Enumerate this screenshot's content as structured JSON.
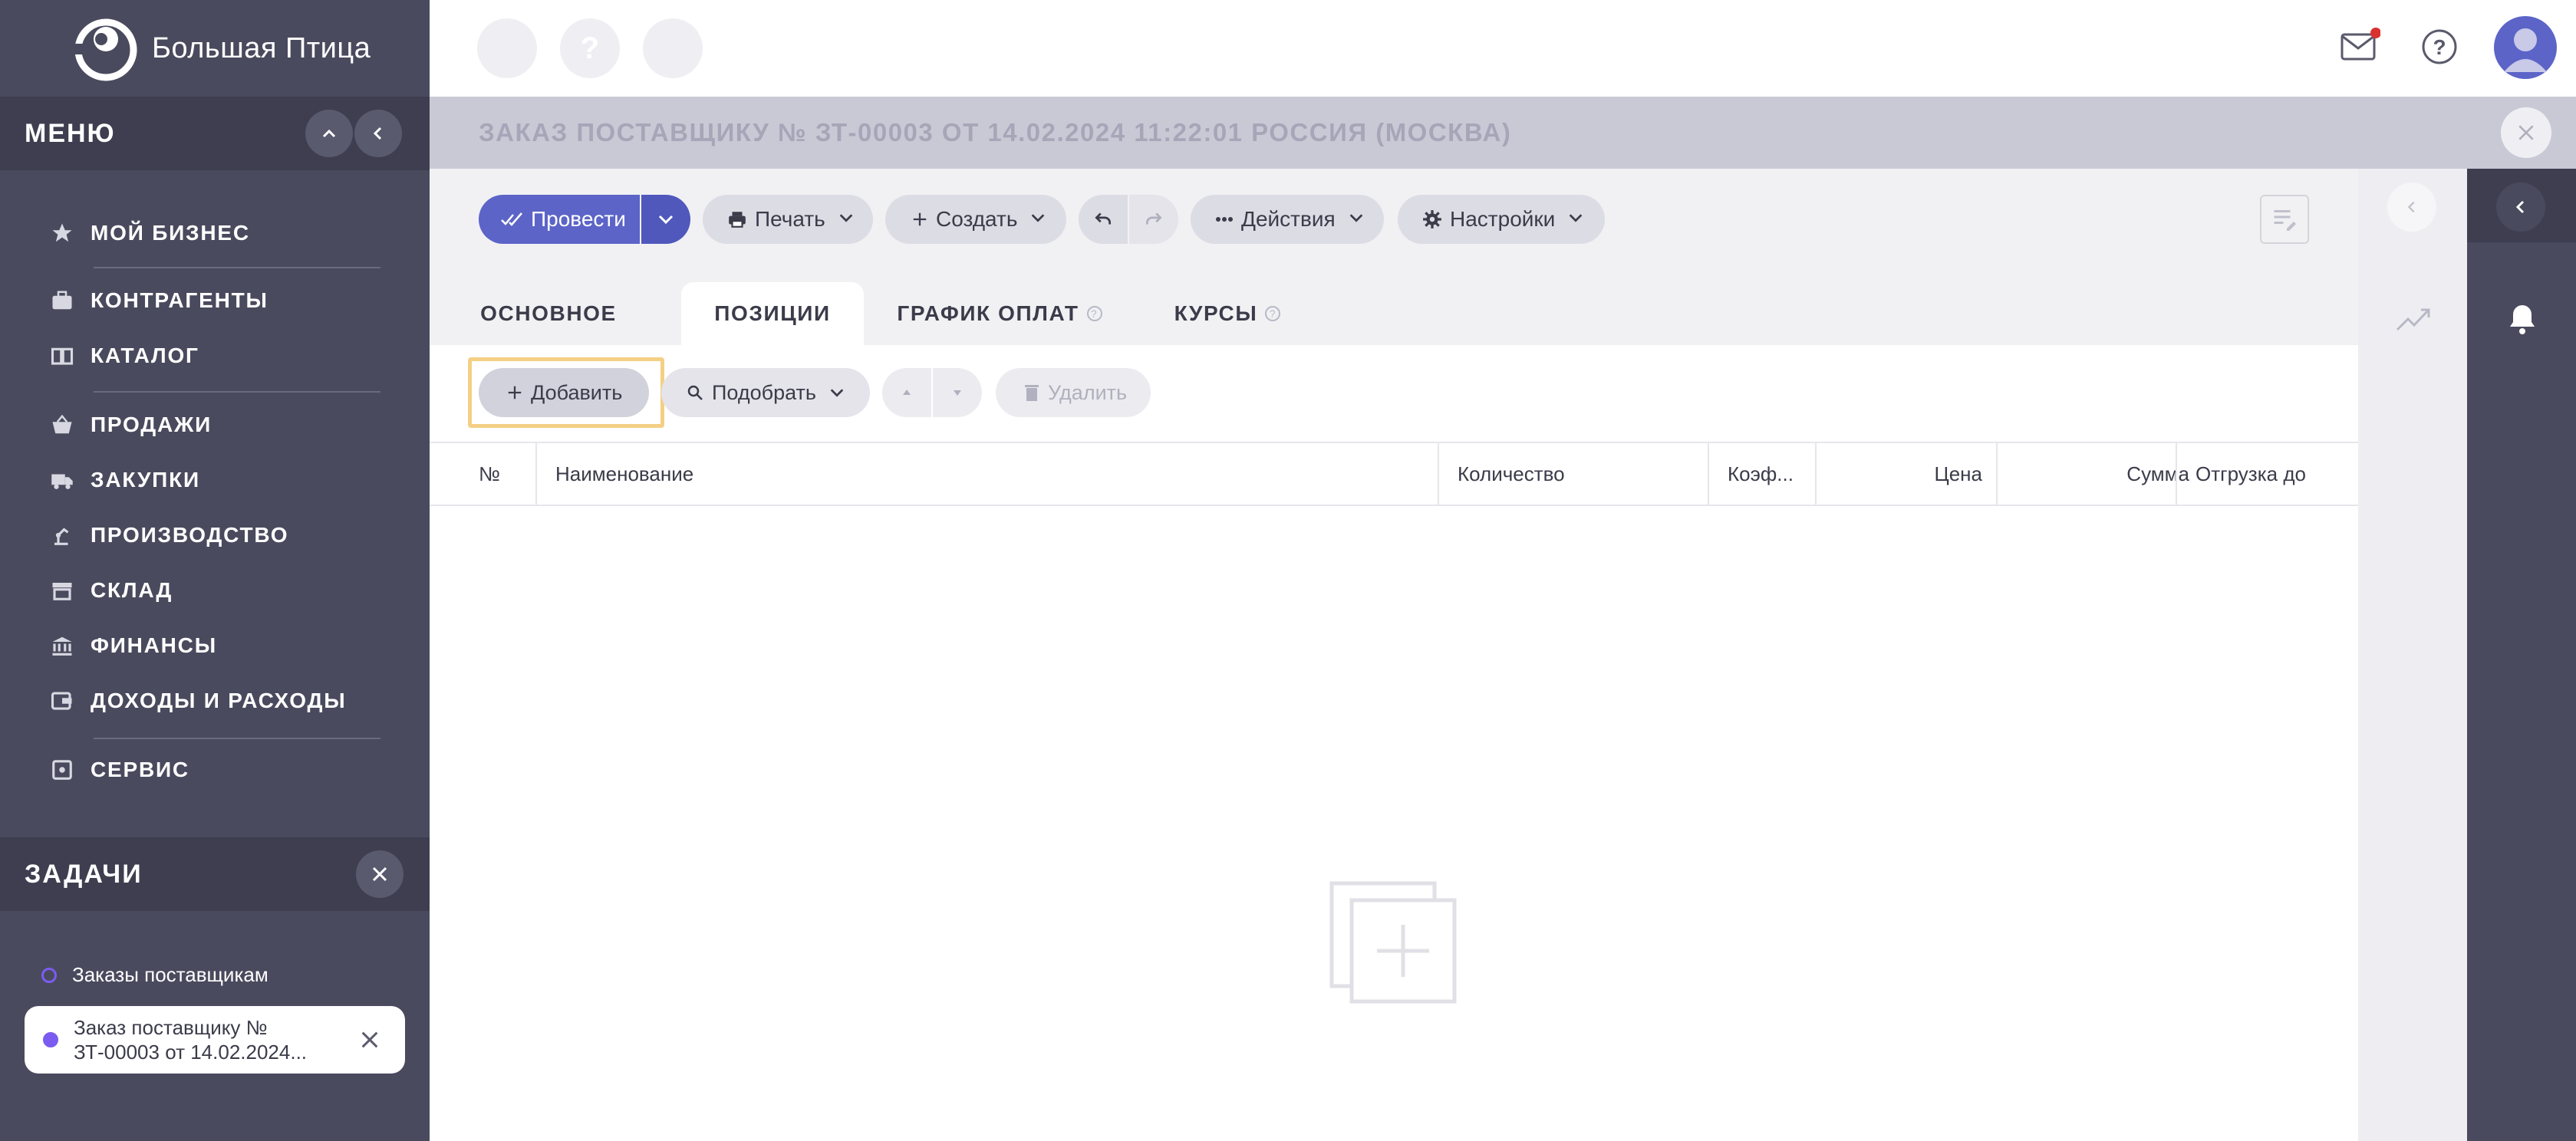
{
  "sidebar": {
    "brand": "Большая Птица",
    "menu_title": "МЕНЮ",
    "items": [
      {
        "label": "МОЙ БИЗНЕС",
        "icon": "star-icon"
      },
      {
        "label": "КОНТРАГЕНТЫ",
        "icon": "briefcase-icon"
      },
      {
        "label": "КАТАЛОГ",
        "icon": "book-icon"
      },
      {
        "label": "ПРОДАЖИ",
        "icon": "basket-icon"
      },
      {
        "label": "ЗАКУПКИ",
        "icon": "truck-icon"
      },
      {
        "label": "ПРОИЗВОДСТВО",
        "icon": "factory-arm-icon"
      },
      {
        "label": "СКЛАД",
        "icon": "store-icon"
      },
      {
        "label": "ФИНАНСЫ",
        "icon": "bank-icon"
      },
      {
        "label": "ДОХОДЫ И РАСХОДЫ",
        "icon": "wallet-icon"
      },
      {
        "label": "СЕРВИС",
        "icon": "service-icon"
      }
    ],
    "tasks_title": "ЗАДАЧИ",
    "task_link": "Заказы поставщикам",
    "task_card": "Заказ поставщику № ЗТ-00003 от 14.02.2024..."
  },
  "document": {
    "title": "ЗАКАЗ ПОСТАВЩИКУ № ЗТ-00003 ОТ 14.02.2024 11:22:01 РОССИЯ (МОСКВА)"
  },
  "toolbar": {
    "post_label": "Провести",
    "print_label": "Печать",
    "create_label": "Создать",
    "actions_label": "Действия",
    "settings_label": "Настройки"
  },
  "tabs": [
    {
      "label": "ОСНОВНОЕ"
    },
    {
      "label": "ПОЗИЦИИ"
    },
    {
      "label": "ГРАФИК ОПЛАТ"
    },
    {
      "label": "КУРСЫ"
    }
  ],
  "positions": {
    "add_label": "Добавить",
    "pick_label": "Подобрать",
    "delete_label": "Удалить",
    "columns": [
      "№",
      "Наименование",
      "Количество",
      "Коэф...",
      "Цена",
      "Сумма",
      "Отгрузка до"
    ]
  },
  "colors": {
    "sidebar": "#4a4a5e",
    "primary": "#5c64c8",
    "accent_dot": "#7b5cf0",
    "notification": "#d93030",
    "focus": "#f4cf84"
  }
}
